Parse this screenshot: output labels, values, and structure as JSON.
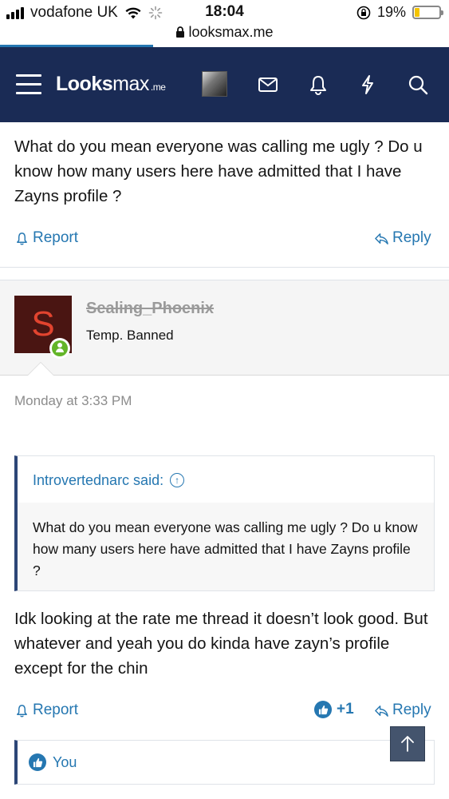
{
  "status_bar": {
    "carrier": "vodafone UK",
    "time": "18:04",
    "battery": "19%",
    "battery_level": 0.19,
    "url": "looksmax.me"
  },
  "header": {
    "logo_bold": "Looks",
    "logo_rest": "max",
    "logo_suffix": ".me"
  },
  "post_previous": {
    "text": "What do you mean everyone was calling me ugly ? Do u know how many users here have admitted that I have Zayns profile ?",
    "report_label": "Report",
    "reply_label": "Reply"
  },
  "post": {
    "avatar_letter": "S",
    "username": "Sealing_Phoenix",
    "user_title": "Temp. Banned",
    "date": "Monday at 3:33 PM",
    "quote": {
      "author_said": "Introvertednarc said:",
      "text": "What do you mean everyone was calling me ugly ? Do u know how many users here have admitted that I have Zayns profile ?"
    },
    "text": "Idk looking at the rate me thread it doesn’t look good. But whatever and yeah you do kinda have zayn’s profile except for the chin",
    "report_label": "Report",
    "reaction_count": "+1",
    "reply_label": "Reply",
    "reactions_label": "You"
  },
  "colors": {
    "header_bg": "#1a2b55",
    "link": "#2577b1",
    "online": "#63b528",
    "avatar_bg": "#4a1512",
    "avatar_letter": "#e2442f"
  }
}
